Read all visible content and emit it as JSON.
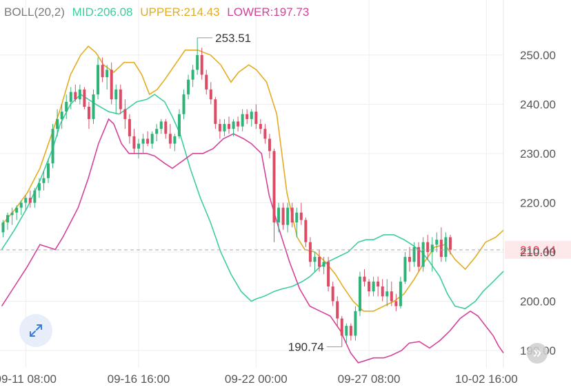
{
  "indicator": {
    "name": "BOLL(20,2)",
    "mid_label": "MID:206.08",
    "upper_label": "UPPER:214.43",
    "lower_label": "LOWER:197.73"
  },
  "colors": {
    "up": "#2fb277",
    "down": "#dd4a63",
    "mid": "#3ccca0",
    "upper": "#e3ac1f",
    "lower": "#d4419a",
    "grid": "#eeeeee",
    "axis_text": "#555555",
    "current_price_bg": "#fde8ea",
    "current_price_text": "#e0435a",
    "current_price_line": "#a8a8a8"
  },
  "icons": {
    "expand": "expand-arrows-icon",
    "scroll_right": "chevron-right-icon"
  },
  "chart_data": {
    "type": "candlestick",
    "y_ticks": [
      250,
      240,
      230,
      220,
      210,
      200,
      190
    ],
    "y_tick_labels": [
      "250.00",
      "240.00",
      "230.00",
      "220.00",
      "210.00",
      "200.00",
      "190.00"
    ],
    "ylim": [
      186.5,
      259.5
    ],
    "x_tick_labels": [
      "09-11 08:00",
      "09-16 16:00",
      "09-22 00:00",
      "09-27 08:00",
      "10-02 16:00"
    ],
    "x_tick_candle_index": [
      5,
      30,
      56,
      81,
      107
    ],
    "candle_count": 100,
    "current_price": 210.44,
    "current_price_label": "210.44",
    "high_marker": {
      "label": "253.51",
      "value": 253.51,
      "candle_index": 43
    },
    "low_marker": {
      "label": "190.74",
      "value": 190.74,
      "candle_index": 75
    },
    "candles": [
      [
        214,
        216.5,
        213,
        216
      ],
      [
        216,
        218,
        214.5,
        217.5
      ],
      [
        217.5,
        219,
        215.5,
        218
      ],
      [
        218,
        219.5,
        216.5,
        219
      ],
      [
        219,
        220.5,
        217.5,
        220
      ],
      [
        220,
        221.5,
        218.5,
        221
      ],
      [
        221,
        222.5,
        219,
        220
      ],
      [
        220,
        223,
        219,
        222.5
      ],
      [
        222.5,
        225,
        221,
        224
      ],
      [
        224,
        226.5,
        222.5,
        225
      ],
      [
        225,
        229,
        224,
        228
      ],
      [
        228,
        236,
        227,
        235
      ],
      [
        235,
        239,
        233.5,
        237
      ],
      [
        237,
        240,
        235,
        238.5
      ],
      [
        238.5,
        242,
        237,
        240.5
      ],
      [
        240.5,
        243.5,
        239,
        242.5
      ],
      [
        242.5,
        244,
        240.5,
        241
      ],
      [
        241,
        244,
        240,
        243
      ],
      [
        243,
        243.5,
        239,
        239.5
      ],
      [
        239.5,
        240.5,
        235,
        237
      ],
      [
        237,
        243,
        236,
        242
      ],
      [
        242,
        249.5,
        241,
        248
      ],
      [
        248,
        249.5,
        244.5,
        245.5
      ],
      [
        245.5,
        248,
        243,
        247
      ],
      [
        247,
        248.5,
        240,
        241
      ],
      [
        241,
        244,
        238,
        243
      ],
      [
        243,
        244,
        238,
        239
      ],
      [
        239,
        241,
        235,
        237
      ],
      [
        237,
        238,
        232,
        233.5
      ],
      [
        233.5,
        235,
        230,
        231
      ],
      [
        231,
        233,
        229,
        232
      ],
      [
        232,
        234,
        230,
        233
      ],
      [
        233,
        234.5,
        231.5,
        232
      ],
      [
        232,
        234.5,
        231,
        234
      ],
      [
        234,
        236,
        232.5,
        235
      ],
      [
        235,
        237,
        234,
        236.5
      ],
      [
        236.5,
        237,
        233,
        234
      ],
      [
        234,
        236,
        231,
        232
      ],
      [
        232,
        234,
        230.5,
        233.5
      ],
      [
        233.5,
        239,
        233,
        238
      ],
      [
        238,
        243,
        237,
        242
      ],
      [
        242,
        246,
        241,
        245
      ],
      [
        245,
        248,
        243.5,
        247
      ],
      [
        247,
        253.51,
        246,
        250
      ],
      [
        250,
        251.5,
        245,
        246
      ],
      [
        246,
        247,
        242,
        243
      ],
      [
        243,
        244.5,
        240,
        241
      ],
      [
        241,
        241.5,
        235,
        236
      ],
      [
        236,
        237,
        233,
        234.5
      ],
      [
        234.5,
        237,
        233.5,
        236
      ],
      [
        236,
        237.5,
        234,
        235
      ],
      [
        235,
        237,
        233.5,
        236.5
      ],
      [
        236.5,
        237.5,
        234.5,
        235.5
      ],
      [
        235.5,
        239,
        234.5,
        238
      ],
      [
        238,
        239,
        236,
        237
      ],
      [
        237,
        239,
        235.5,
        238.5
      ],
      [
        238.5,
        240,
        235,
        236
      ],
      [
        236,
        237,
        234,
        235
      ],
      [
        235,
        236,
        232,
        233
      ],
      [
        233,
        234,
        229,
        230.5
      ],
      [
        230.5,
        231,
        212,
        216
      ],
      [
        216,
        220,
        214,
        219
      ],
      [
        219,
        220,
        214.5,
        215.5
      ],
      [
        215.5,
        220,
        214,
        219
      ],
      [
        219,
        220,
        215,
        216
      ],
      [
        216,
        219,
        213,
        218
      ],
      [
        218,
        220,
        215.5,
        216.5
      ],
      [
        216.5,
        217,
        211,
        212
      ],
      [
        212,
        213,
        207,
        208
      ],
      [
        208,
        210,
        206,
        209
      ],
      [
        209,
        210.5,
        206,
        207
      ],
      [
        207,
        209,
        205.5,
        208
      ],
      [
        208,
        209,
        202,
        203
      ],
      [
        203,
        204,
        199,
        200
      ],
      [
        200,
        201,
        195,
        196.5
      ],
      [
        196.5,
        197,
        190.74,
        193
      ],
      [
        193,
        195.5,
        191.5,
        195
      ],
      [
        195,
        195.5,
        192,
        193
      ],
      [
        193,
        199,
        192,
        198
      ],
      [
        198,
        206,
        197,
        205
      ],
      [
        205,
        206.5,
        203,
        204
      ],
      [
        204,
        204.5,
        201,
        202
      ],
      [
        202,
        205,
        201,
        204
      ],
      [
        204,
        205,
        201,
        203
      ],
      [
        203,
        204.5,
        200,
        201
      ],
      [
        201,
        204.5,
        199,
        202
      ],
      [
        202,
        204,
        199,
        200
      ],
      [
        200,
        201.5,
        198,
        199
      ],
      [
        199,
        205,
        198.5,
        204
      ],
      [
        204,
        210,
        203.5,
        209
      ],
      [
        209,
        211,
        206,
        208
      ],
      [
        208,
        212,
        207,
        211
      ],
      [
        211,
        212,
        206,
        207
      ],
      [
        207,
        213,
        206,
        212
      ],
      [
        212,
        213.5,
        208.5,
        210
      ],
      [
        210,
        213,
        206,
        211.5
      ],
      [
        211.5,
        214,
        210,
        212.5
      ],
      [
        212.5,
        215,
        208,
        209
      ],
      [
        209,
        214,
        208,
        213
      ],
      [
        213,
        213.5,
        209.5,
        210.44
      ]
    ],
    "mid": [
      [
        0,
        210.5
      ],
      [
        5,
        214.5
      ],
      [
        10,
        219
      ],
      [
        15,
        224.5
      ],
      [
        20,
        231
      ],
      [
        23,
        236
      ],
      [
        27,
        240
      ],
      [
        31,
        242
      ],
      [
        37,
        240
      ],
      [
        42,
        238.5
      ],
      [
        46,
        238
      ],
      [
        49,
        239
      ],
      [
        53,
        240.5
      ],
      [
        57,
        241
      ],
      [
        60,
        242
      ],
      [
        64,
        240.5
      ],
      [
        67,
        237.5
      ],
      [
        70,
        234
      ],
      [
        74,
        227
      ],
      [
        78,
        221
      ],
      [
        82,
        216
      ],
      [
        86,
        210
      ],
      [
        90,
        205.5
      ],
      [
        94,
        202
      ],
      [
        98,
        200
      ],
      [
        100,
        200.5
      ],
      [
        103,
        201
      ],
      [
        107,
        202
      ],
      [
        110,
        202.5
      ],
      [
        114,
        203
      ],
      [
        118,
        204
      ],
      [
        121,
        205
      ],
      [
        123,
        206
      ],
      [
        125,
        207
      ],
      [
        128,
        208
      ],
      [
        132,
        209
      ],
      [
        136,
        210
      ],
      [
        140,
        212
      ],
      [
        143,
        212.5
      ],
      [
        146,
        212.5
      ],
      [
        150,
        213.5
      ],
      [
        154,
        213.5
      ],
      [
        158,
        212.5
      ],
      [
        161,
        211.5
      ],
      [
        165,
        210
      ],
      [
        168,
        208
      ],
      [
        172,
        205
      ],
      [
        175,
        201.5
      ],
      [
        178,
        199
      ],
      [
        182,
        198.5
      ],
      [
        186,
        200
      ],
      [
        189,
        202
      ],
      [
        193,
        204
      ],
      [
        197,
        206.08
      ]
    ],
    "upper": [
      [
        0,
        215.5
      ],
      [
        5,
        218.5
      ],
      [
        10,
        222
      ],
      [
        15,
        227
      ],
      [
        20,
        234.5
      ],
      [
        23,
        239
      ],
      [
        27,
        246
      ],
      [
        31,
        250
      ],
      [
        34,
        251.8
      ],
      [
        37,
        250.5
      ],
      [
        40,
        248
      ],
      [
        44,
        246.5
      ],
      [
        48,
        248.5
      ],
      [
        52,
        248.5
      ],
      [
        55,
        246
      ],
      [
        58,
        242
      ],
      [
        61,
        243
      ],
      [
        64,
        245
      ],
      [
        68,
        248
      ],
      [
        72,
        251
      ],
      [
        77,
        251
      ],
      [
        82,
        250
      ],
      [
        86,
        248
      ],
      [
        90,
        244.5
      ],
      [
        93,
        246.5
      ],
      [
        97,
        248
      ],
      [
        100,
        247
      ],
      [
        104,
        244.5
      ],
      [
        108,
        238
      ],
      [
        112,
        222
      ],
      [
        116,
        213
      ],
      [
        119,
        210.5
      ],
      [
        123,
        210
      ],
      [
        127,
        208
      ],
      [
        131,
        205.5
      ],
      [
        134,
        203
      ],
      [
        138,
        200
      ],
      [
        142,
        198
      ],
      [
        146,
        198
      ],
      [
        150,
        199
      ],
      [
        154,
        200
      ],
      [
        158,
        201.5
      ],
      [
        162,
        204.5
      ],
      [
        166,
        208
      ],
      [
        170,
        211
      ],
      [
        174,
        211.5
      ],
      [
        178,
        208.5
      ],
      [
        182,
        206.5
      ],
      [
        186,
        209
      ],
      [
        190,
        212
      ],
      [
        194,
        213
      ],
      [
        197,
        214.43
      ]
    ],
    "lower": [
      [
        0,
        199
      ],
      [
        5,
        203
      ],
      [
        10,
        207
      ],
      [
        15,
        211.5
      ],
      [
        18,
        211
      ],
      [
        21,
        210.5
      ],
      [
        24,
        213
      ],
      [
        27,
        216
      ],
      [
        30,
        219
      ],
      [
        34,
        225
      ],
      [
        38,
        232
      ],
      [
        42,
        237
      ],
      [
        44,
        236
      ],
      [
        47,
        232
      ],
      [
        50,
        230
      ],
      [
        54,
        230
      ],
      [
        57,
        230
      ],
      [
        60,
        229.5
      ],
      [
        64,
        228
      ],
      [
        67,
        227
      ],
      [
        71,
        228.5
      ],
      [
        75,
        230
      ],
      [
        79,
        230
      ],
      [
        83,
        231
      ],
      [
        87,
        233
      ],
      [
        91,
        234
      ],
      [
        95,
        233
      ],
      [
        98,
        232
      ],
      [
        102,
        230
      ],
      [
        105,
        221.5
      ],
      [
        109,
        214.5
      ],
      [
        113,
        208
      ],
      [
        117,
        202.5
      ],
      [
        121,
        199
      ],
      [
        125,
        198
      ],
      [
        129,
        197
      ],
      [
        133,
        194
      ],
      [
        137,
        189.5
      ],
      [
        140,
        187.5
      ],
      [
        143,
        188
      ],
      [
        146,
        188.5
      ],
      [
        150,
        188.5
      ],
      [
        153,
        189
      ],
      [
        157,
        190
      ],
      [
        160,
        191.5
      ],
      [
        164,
        191.8
      ],
      [
        168,
        190.5
      ],
      [
        172,
        192
      ],
      [
        176,
        194
      ],
      [
        180,
        196.5
      ],
      [
        184,
        198
      ],
      [
        187,
        197
      ],
      [
        190,
        195
      ],
      [
        193,
        193
      ],
      [
        195,
        191
      ],
      [
        197,
        189.5
      ]
    ]
  }
}
